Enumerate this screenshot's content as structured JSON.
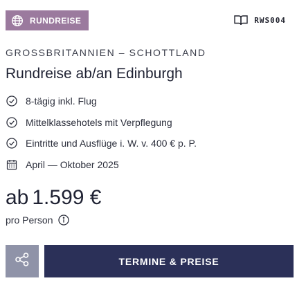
{
  "badge": {
    "label": "RUNDREISE",
    "icon": "globe-icon",
    "color": "#9b7a9e"
  },
  "code": {
    "label": "RWS004",
    "icon": "catalog-book-icon"
  },
  "region": "GROSSBRITANNIEN – SCHOTTLAND",
  "title": "Rundreise ab/an Edinburgh",
  "features": [
    {
      "icon": "check-circle-icon",
      "text": "8-tägig inkl. Flug"
    },
    {
      "icon": "check-circle-icon",
      "text": "Mittelklassehotels mit Verpflegung"
    },
    {
      "icon": "check-circle-icon",
      "text": "Eintritte und Ausflüge i. W. v. 400 € p. P."
    },
    {
      "icon": "calendar-icon",
      "text": "April — Oktober 2025"
    }
  ],
  "price": {
    "prefix": "ab",
    "amount": "1.599 €",
    "per_label": "pro Person",
    "info_icon": "info-icon"
  },
  "actions": {
    "share_icon": "share-icon",
    "share_color": "#8f93a8",
    "cta_label": "TERMINE & PREISE",
    "cta_color": "#2b3058"
  }
}
